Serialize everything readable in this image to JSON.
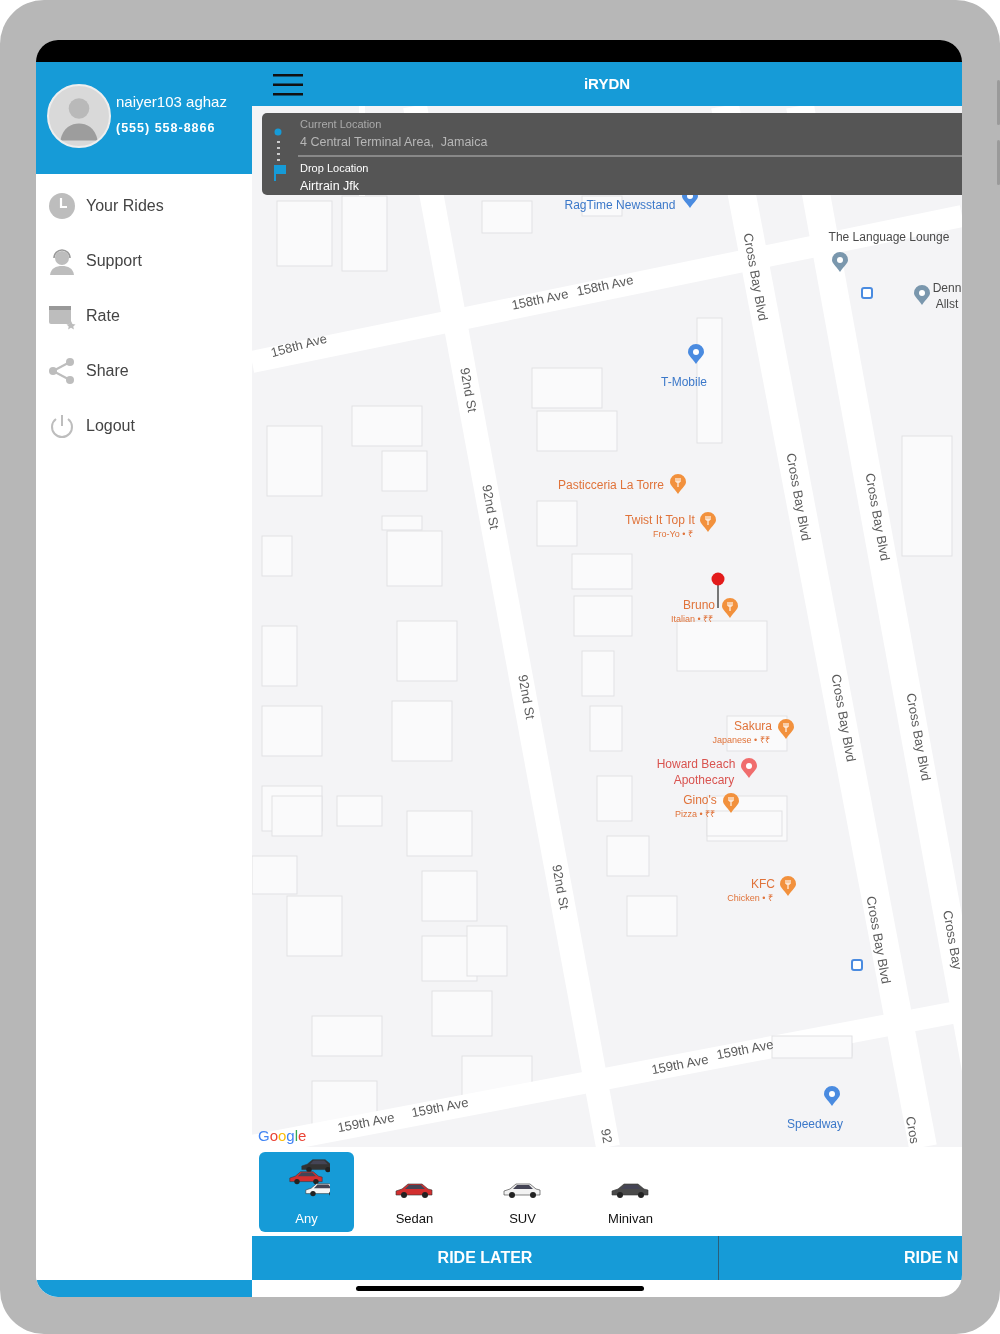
{
  "profile": {
    "name": "naiyer103 aghaz",
    "phone": "(555) 558-8866"
  },
  "menu": [
    {
      "label": "Your Rides",
      "kind": "clock"
    },
    {
      "label": "Support",
      "kind": "support"
    },
    {
      "label": "Rate",
      "kind": "rate"
    },
    {
      "label": "Share",
      "kind": "share"
    },
    {
      "label": "Logout",
      "kind": "power"
    }
  ],
  "header": {
    "title": "iRYDN"
  },
  "route": {
    "pickup_label": "Current Location",
    "pickup": "4 Central Terminal Area,  Jamaica",
    "drop_label": "Drop Location",
    "drop": "Airtrain Jfk"
  },
  "map_labels": [
    {
      "text": "RagTime Newsstand",
      "kind": "blue"
    },
    {
      "text": "The Language Lounge",
      "kind": "place"
    },
    {
      "text": "Denn",
      "kind": "place"
    },
    {
      "text": "Allst",
      "kind": "place"
    },
    {
      "text": "158th Ave",
      "kind": "street"
    },
    {
      "text": "158th Ave",
      "kind": "street"
    },
    {
      "text": "158th Ave",
      "kind": "street"
    },
    {
      "text": "Cross Bay Blvd",
      "kind": "street"
    },
    {
      "text": "Cross Bay Blvd",
      "kind": "street"
    },
    {
      "text": "Cross Bay Blvd",
      "kind": "street"
    },
    {
      "text": "Cross Bay Blvd",
      "kind": "street"
    },
    {
      "text": "Cross Bay Blvd",
      "kind": "street"
    },
    {
      "text": "Cross Bay Blvd",
      "kind": "street"
    },
    {
      "text": "Cross Bay",
      "kind": "street"
    },
    {
      "text": "Cros",
      "kind": "street"
    },
    {
      "text": "92nd St",
      "kind": "street"
    },
    {
      "text": "92nd St",
      "kind": "street"
    },
    {
      "text": "92nd St",
      "kind": "street"
    },
    {
      "text": "92nd St",
      "kind": "street"
    },
    {
      "text": "92",
      "kind": "street"
    },
    {
      "text": "T-Mobile",
      "kind": "blue"
    },
    {
      "text": "Pasticceria La Torre",
      "kind": "food"
    },
    {
      "text": "Twist It Top It",
      "kind": "food"
    },
    {
      "text": "Fro-Yo • ₹",
      "kind": "detail"
    },
    {
      "text": "Bruno",
      "kind": "food"
    },
    {
      "text": "Italian • ₹₹",
      "kind": "detail"
    },
    {
      "text": "Sakura",
      "kind": "food"
    },
    {
      "text": "Japanese • ₹₹",
      "kind": "detail"
    },
    {
      "text": "Howard Beach",
      "kind": "shop"
    },
    {
      "text": "Apothecary",
      "kind": "shop"
    },
    {
      "text": "Gino's",
      "kind": "food"
    },
    {
      "text": "Pizza • ₹₹",
      "kind": "detail"
    },
    {
      "text": "KFC",
      "kind": "food"
    },
    {
      "text": "Chicken • ₹",
      "kind": "detail"
    },
    {
      "text": "159th Ave",
      "kind": "street"
    },
    {
      "text": "159th Ave",
      "kind": "street"
    },
    {
      "text": "159th Ave",
      "kind": "street"
    },
    {
      "text": "159th Ave",
      "kind": "street"
    },
    {
      "text": "Speedway",
      "kind": "blue"
    }
  ],
  "map_logo": "Google",
  "car_types": [
    {
      "label": "Any",
      "kind": "any",
      "selected": true
    },
    {
      "label": "Sedan",
      "kind": "sedan",
      "selected": false
    },
    {
      "label": "SUV",
      "kind": "suv",
      "selected": false
    },
    {
      "label": "Minivan",
      "kind": "minivan",
      "selected": false
    }
  ],
  "actions": [
    {
      "label": "RIDE LATER"
    },
    {
      "label": "RIDE N"
    }
  ]
}
